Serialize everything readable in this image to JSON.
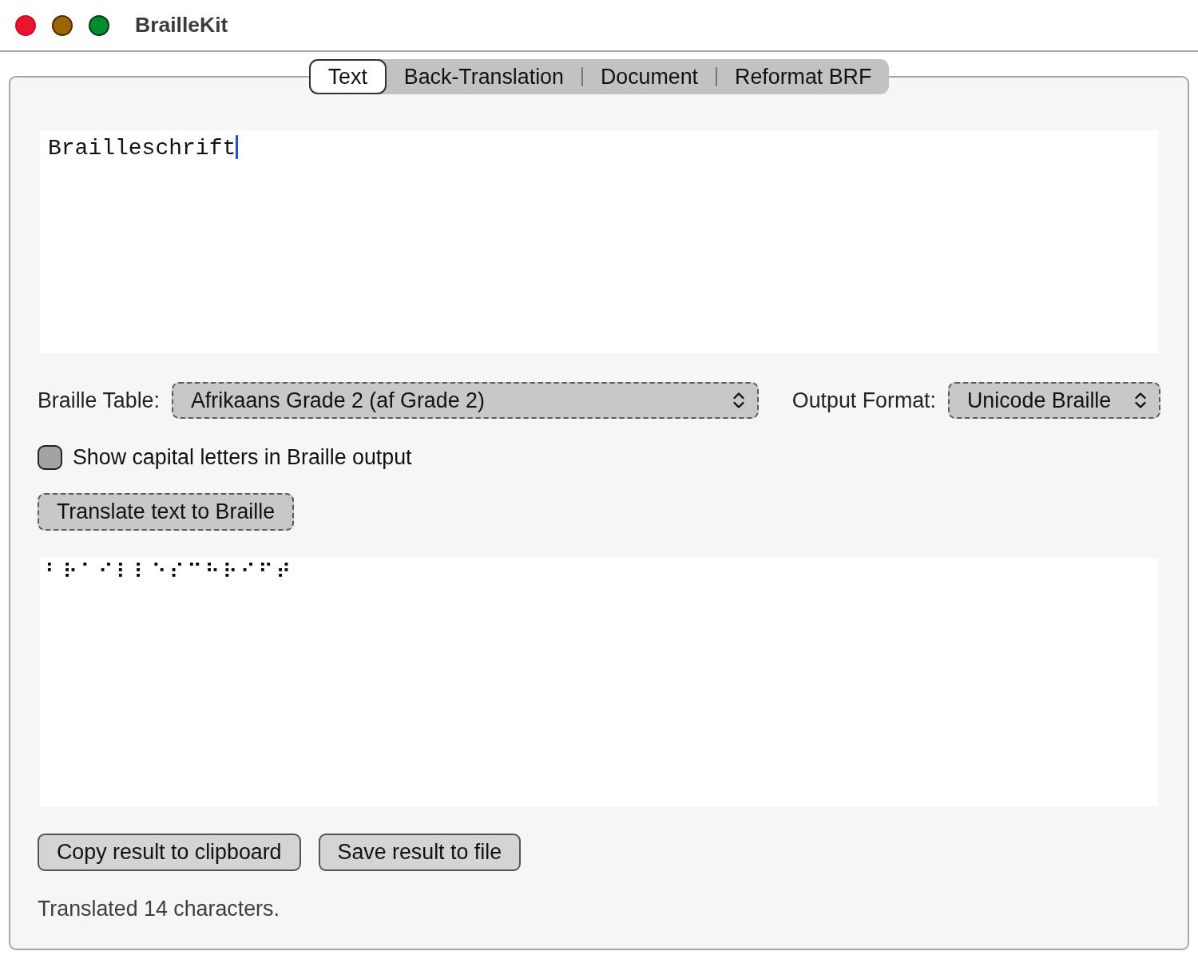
{
  "window": {
    "title": "BrailleKit"
  },
  "tabs": [
    {
      "label": "Text",
      "selected": true
    },
    {
      "label": "Back-Translation",
      "selected": false
    },
    {
      "label": "Document",
      "selected": false
    },
    {
      "label": "Reformat BRF",
      "selected": false
    }
  ],
  "input": {
    "value": "Brailleschrift",
    "focused": true
  },
  "braille_table": {
    "label": "Braille Table:",
    "value": "Afrikaans Grade 2 (af Grade 2)"
  },
  "output_format": {
    "label": "Output Format:",
    "value": "Unicode Braille"
  },
  "show_capitals": {
    "label": "Show capital letters in Braille output",
    "checked": false
  },
  "translate_button": "Translate text to Braille",
  "output": {
    "value": "⠃⠗⠁⠊⠇⠇⠑⠎⠉⠓⠗⠊⠋⠞"
  },
  "buttons": [
    "Copy result to clipboard",
    "Save result to file"
  ],
  "status_bar": "Translated 14 characters."
}
